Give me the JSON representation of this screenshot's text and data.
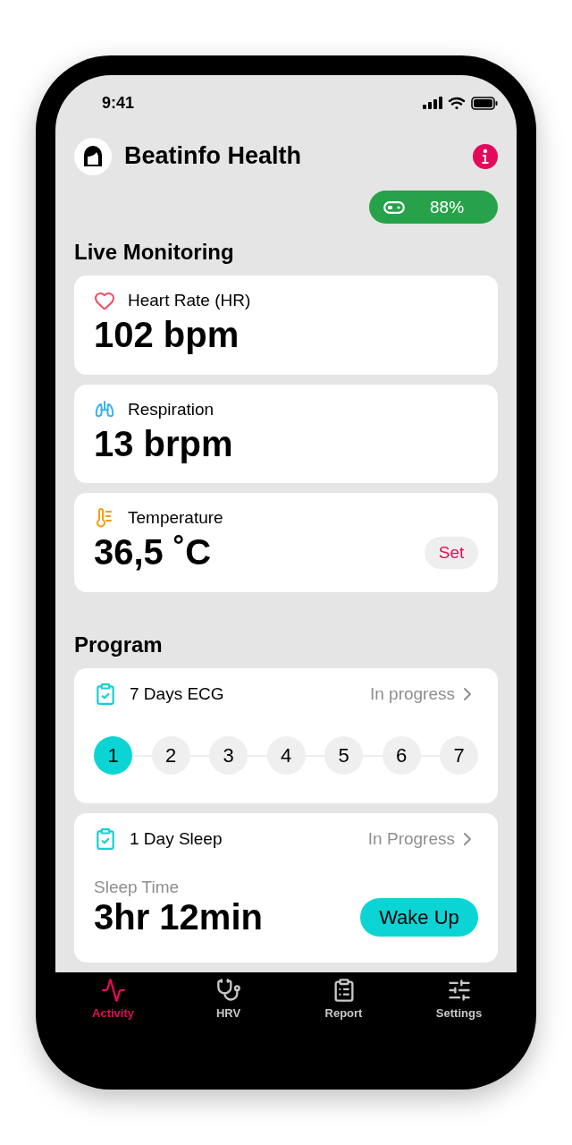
{
  "status_bar": {
    "time": "9:41"
  },
  "header": {
    "title": "Beatinfo Health"
  },
  "device_battery": {
    "reading": "88%"
  },
  "live_monitoring": {
    "title": "Live Monitoring",
    "cards": [
      {
        "kind": "heart",
        "label": "Heart Rate (HR)",
        "value": "102 bpm"
      },
      {
        "kind": "lungs",
        "label": "Respiration",
        "value": "13 brpm"
      },
      {
        "kind": "temperature",
        "label": "Temperature",
        "value": "36,5 ˚C",
        "action": "Set"
      }
    ]
  },
  "program": {
    "title": "Program",
    "cards": [
      {
        "kind": "steps",
        "title": "7 Days ECG",
        "status": "In progress",
        "days": [
          {
            "label": "1",
            "selected": true
          },
          {
            "label": "2",
            "selected": false
          },
          {
            "label": "3",
            "selected": false
          },
          {
            "label": "4",
            "selected": false
          },
          {
            "label": "5",
            "selected": false
          },
          {
            "label": "6",
            "selected": false
          },
          {
            "label": "7",
            "selected": false
          }
        ]
      },
      {
        "kind": "timer",
        "title": "1 Day Sleep",
        "status": "In Progress",
        "caption": "Sleep Time",
        "value": "3hr 12min",
        "action": "Wake Up"
      }
    ]
  },
  "tab_bar": [
    {
      "kind": "activity",
      "label": "Activity",
      "selected": true
    },
    {
      "kind": "stethoscope",
      "label": "HRV",
      "selected": false
    },
    {
      "kind": "report",
      "label": "Report",
      "selected": false
    },
    {
      "kind": "settings",
      "label": "Settings",
      "selected": false
    }
  ]
}
